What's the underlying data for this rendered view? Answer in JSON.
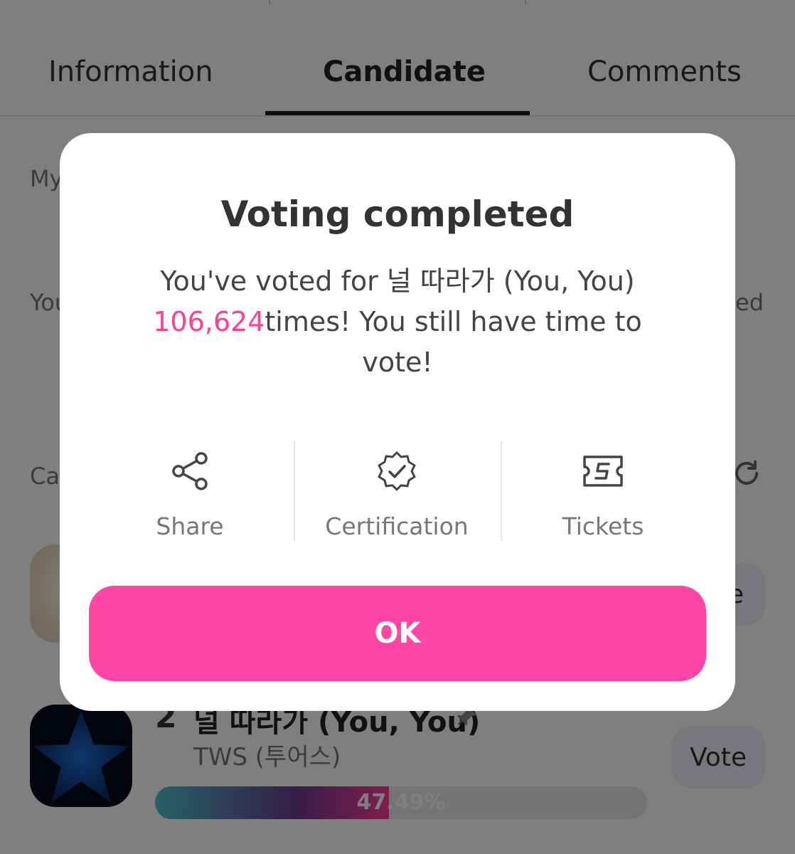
{
  "tabs": [
    {
      "label": "Information"
    },
    {
      "label": "Candidate"
    },
    {
      "label": "Comments"
    }
  ],
  "background": {
    "my_label_partial": "My",
    "you_label_partial": "You",
    "right_label_partial": "ed",
    "candidates_label_partial": "Ca",
    "candidate_1": {
      "vote_label_partial": "e"
    },
    "candidate_2": {
      "rank": "2",
      "title": "널 따라가 (You, You)",
      "artist": "TWS (투어스)",
      "vote_label": "Vote",
      "percent_text": "47.49%",
      "percent_value": 47.49
    }
  },
  "modal": {
    "title": "Voting completed",
    "message_prefix": "You've voted for 널 따라가 (You, You) ",
    "count": "106,624",
    "message_suffix": "times! You still have time to vote!",
    "actions": [
      {
        "label": "Share",
        "icon": "share-icon"
      },
      {
        "label": "Certification",
        "icon": "verified-badge-icon"
      },
      {
        "label": "Tickets",
        "icon": "ticket-icon"
      }
    ],
    "ok_label": "OK"
  },
  "colors": {
    "accent": "#ff45a6",
    "highlight": "#ff3d9a",
    "overlay": "rgba(0,0,0,0.5)"
  }
}
